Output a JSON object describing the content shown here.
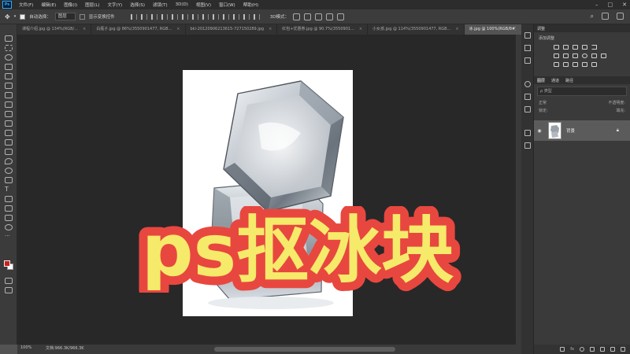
{
  "menu": {
    "logo": "Ps",
    "items": [
      "文件(F)",
      "编辑(E)",
      "图像(I)",
      "图层(L)",
      "文字(Y)",
      "选择(S)",
      "滤镜(T)",
      "3D(D)",
      "视图(V)",
      "窗口(W)",
      "帮助(H)"
    ]
  },
  "options": {
    "auto_select_label": "自动选择：",
    "auto_select_value": "图层",
    "show_transform_label": "显示变换控件"
  },
  "tabs": [
    {
      "label": "课程介绍.jpg @ 134%(RGB/..."
    },
    {
      "label": "白瓶子.jpg @ 86%(3550901477, RGB..."
    },
    {
      "label": "bki-20120906213615-727150289.jpg"
    },
    {
      "label": "红包+优惠券.jpg @ 90.7%(3550901..."
    },
    {
      "label": "小女孩.jpg @ 114%(3550901477, RGB..."
    },
    {
      "label": "冰.jpg @ 100%(RGB/8#)",
      "active": true
    }
  ],
  "overlay_title": "ps抠冰块",
  "status": {
    "zoom": "100%",
    "doc_info": "文档:966.3K/966.3K"
  },
  "panels": {
    "adjust_tab": "调整",
    "adjust_add": "添加调整",
    "layers_tabs": [
      "图层",
      "通道",
      "路径"
    ],
    "filter_placeholder": "ρ 类型",
    "blend_mode": "正常",
    "opacity_label": "不透明度:",
    "lock_label": "锁定:",
    "fill_label": "填充:",
    "layer_name": "背景",
    "footer_icons": [
      "link-icon",
      "fx-icon",
      "mask-icon",
      "adjustment-icon",
      "group-icon",
      "new-layer-icon",
      "trash-icon"
    ]
  },
  "colors": {
    "foreground": "#cc2020",
    "background": "#ffffff",
    "title_fill": "#f6ea6a",
    "title_outline": "#e8473f"
  }
}
